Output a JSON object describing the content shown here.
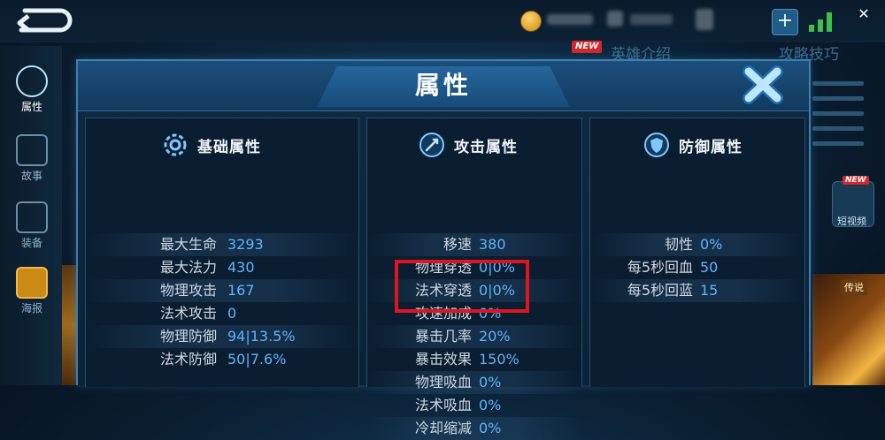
{
  "nav": {
    "back_icon": "back-arrow-icon",
    "items": [
      {
        "label": "属性",
        "icon": "gear-icon"
      },
      {
        "label": "故事",
        "icon": "book-icon"
      },
      {
        "label": "装备",
        "icon": "shield-sword-icon"
      },
      {
        "label": "海报",
        "icon": "poster-icon"
      }
    ]
  },
  "tabs": {
    "new_badge": "NEW",
    "hero_intro": "英雄介绍",
    "tips": "攻略技巧"
  },
  "side": {
    "video_badge": "NEW",
    "video_label": "短视频",
    "skin_tag": "传说"
  },
  "dialog": {
    "title": "属性",
    "close_icon": "close-x-icon",
    "panels": {
      "basic": {
        "title": "基础属性",
        "icon": "gear-icon",
        "rows": [
          {
            "label": "最大生命",
            "value": "3293"
          },
          {
            "label": "最大法力",
            "value": "430"
          },
          {
            "label": "物理攻击",
            "value": "167"
          },
          {
            "label": "法术攻击",
            "value": "0"
          },
          {
            "label": "物理防御",
            "value": "94|13.5%"
          },
          {
            "label": "法术防御",
            "value": "50|7.6%"
          }
        ]
      },
      "attack": {
        "title": "攻击属性",
        "icon": "sword-icon",
        "rows": [
          {
            "label": "移速",
            "value": "380"
          },
          {
            "label": "物理穿透",
            "value": "0|0%"
          },
          {
            "label": "法术穿透",
            "value": "0|0%"
          },
          {
            "label": "攻速加成",
            "value": "0%"
          },
          {
            "label": "暴击几率",
            "value": "20%"
          },
          {
            "label": "暴击效果",
            "value": "150%"
          },
          {
            "label": "物理吸血",
            "value": "0%"
          },
          {
            "label": "法术吸血",
            "value": "0%"
          },
          {
            "label": "冷却缩减",
            "value": "0%"
          }
        ]
      },
      "defense": {
        "title": "防御属性",
        "icon": "shield-icon",
        "rows": [
          {
            "label": "韧性",
            "value": "0%"
          },
          {
            "label": "每5秒回血",
            "value": "50"
          },
          {
            "label": "每5秒回蓝",
            "value": "15"
          }
        ]
      }
    }
  },
  "colors": {
    "value_blue": "#5fb4ff",
    "highlight_red": "#e0141e",
    "title_white": "#ffffff"
  }
}
